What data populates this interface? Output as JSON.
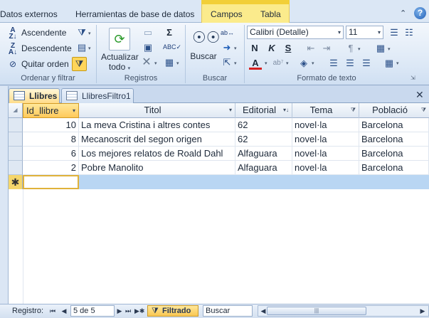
{
  "ribbon_tabs": {
    "external_data": "Datos externos",
    "db_tools": "Herramientas de base de datos",
    "fields": "Campos",
    "table": "Tabla"
  },
  "sort_filter": {
    "ascending": "Ascendente",
    "descending": "Descendente",
    "remove_sort": "Quitar orden",
    "group_label": "Ordenar y filtrar"
  },
  "records": {
    "refresh_line1": "Actualizar",
    "refresh_line2": "todo",
    "group_label": "Registros"
  },
  "find": {
    "find_label": "Buscar",
    "group_label": "Buscar"
  },
  "text_format": {
    "font_name": "Calibri (Detalle)",
    "font_size": "11",
    "group_label": "Formato de texto",
    "bold": "N",
    "italic": "K",
    "underline": "S"
  },
  "doc_tabs": {
    "tab1": "Llibres",
    "tab2": "LlibresFiltro1"
  },
  "columns": {
    "id": "Id_llibre",
    "titol": "Titol",
    "editorial": "Editorial",
    "tema": "Tema",
    "poblacio": "Població"
  },
  "rows": [
    {
      "id": "10",
      "titol": "La meva Cristina i altres contes",
      "editorial": "62",
      "tema": "novel·la",
      "poblacio": "Barcelona"
    },
    {
      "id": "8",
      "titol": "Mecanoscrit del segon origen",
      "editorial": "62",
      "tema": "novel·la",
      "poblacio": "Barcelona"
    },
    {
      "id": "6",
      "titol": "Los mejores relatos de Roald Dahl",
      "editorial": "Alfaguara",
      "tema": "novel·la",
      "poblacio": "Barcelona"
    },
    {
      "id": "2",
      "titol": "Pobre Manolito",
      "editorial": "Alfaguara",
      "tema": "novel·la",
      "poblacio": "Barcelona"
    }
  ],
  "nav": {
    "label": "Registro:",
    "current": "5 de 5",
    "filter_status": "Filtrado",
    "search_placeholder": "Buscar"
  },
  "colors": {
    "accent_tab": "#fbeb8c",
    "active_filter": "#ffd55a",
    "new_row": "#b9d6f3"
  }
}
